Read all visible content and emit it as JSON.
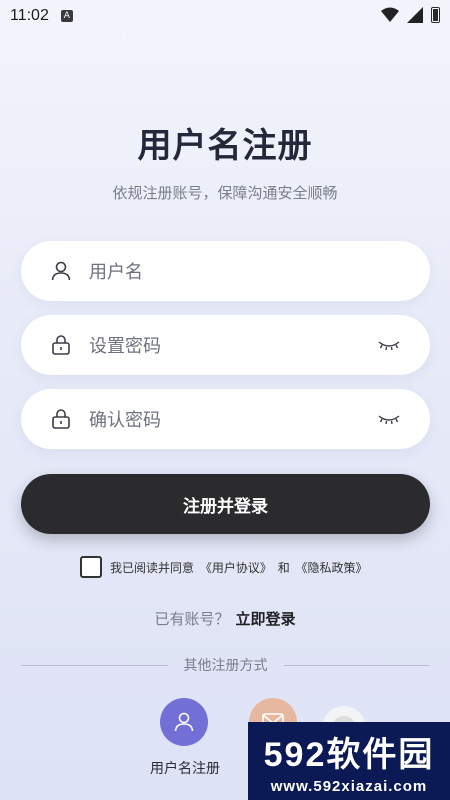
{
  "status_bar": {
    "time": "11:02",
    "notification_icon_letter": "A"
  },
  "page": {
    "title": "用户名注册",
    "subtitle": "依规注册账号，保障沟通安全顺畅"
  },
  "form": {
    "username": {
      "placeholder": "用户名"
    },
    "password": {
      "placeholder": "设置密码"
    },
    "confirm_password": {
      "placeholder": "确认密码"
    },
    "submit_label": "注册并登录"
  },
  "agreement": {
    "prefix": "我已阅读并同意",
    "user_agreement": "《用户协议》",
    "and": "和",
    "privacy_policy": "《隐私政策》",
    "checked": false
  },
  "login_prompt": {
    "question": "已有账号？",
    "link": "立即登录"
  },
  "other_methods": {
    "divider_text": "其他注册方式",
    "options": [
      {
        "label": "用户名注册",
        "icon": "user-icon",
        "color": "#7270d6"
      },
      {
        "label": "",
        "icon": "mail-icon",
        "color": "#e7b8a0"
      },
      {
        "label": "",
        "icon": "avatar-icon",
        "color": "#f4f4f6"
      }
    ]
  },
  "watermark": {
    "brand": "592软件园",
    "url": "www.592xiazai.com"
  },
  "colors": {
    "accent": "#2b2b2d",
    "social_user": "#7270d6",
    "watermark_bg": "#0b1a54"
  }
}
